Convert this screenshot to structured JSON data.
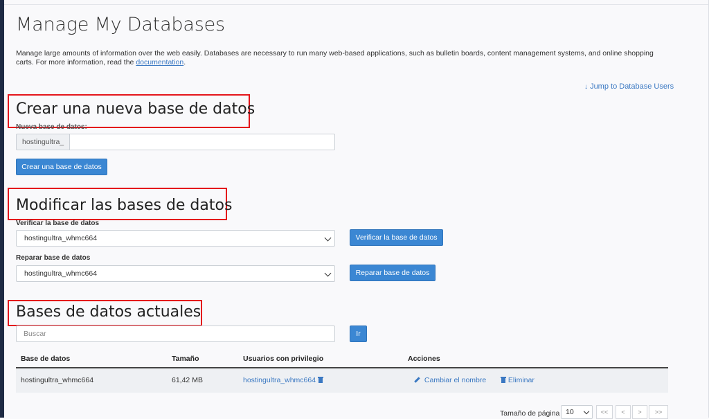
{
  "page": {
    "title": "Manage My Databases",
    "intro_text": "Manage large amounts of information over the web easily. Databases are necessary to run many web-based applications, such as bulletin boards, content management systems, and online shopping carts. For more information, read the",
    "intro_link": "documentation",
    "intro_end": ".",
    "jump_link": "Jump to Database Users"
  },
  "create": {
    "heading": "Crear una nueva base de datos",
    "label": "Nueva base de datos:",
    "prefix": "hostingultra_",
    "input_value": "",
    "button": "Crear una base de datos"
  },
  "modify": {
    "heading": "Modificar las bases de datos",
    "verify_label": "Verificar la base de datos",
    "verify_selected": "hostingultra_whmc664",
    "verify_button": "Verificar la base de datos",
    "repair_label": "Reparar base de datos",
    "repair_selected": "hostingultra_whmc664",
    "repair_button": "Reparar base de datos"
  },
  "current": {
    "heading": "Bases de datos actuales",
    "search_placeholder": "Buscar",
    "go_button": "Ir",
    "columns": [
      "Base de datos",
      "Tamaño",
      "Usuarios con privilegio",
      "Acciones"
    ],
    "rows": [
      {
        "database": "hostingultra_whmc664",
        "size": "61,42 MB",
        "user": "hostingultra_whmc664",
        "rename": "Cambiar el nombre",
        "delete": "Eliminar"
      }
    ],
    "page_size_label": "Tamaño de página",
    "page_size": "10",
    "pager": [
      "<<",
      "<",
      ">",
      ">>"
    ]
  },
  "colors": {
    "accent": "#3b87d3",
    "link": "#3a78c2",
    "highlight": "#e4151b"
  },
  "icons": [
    "arrow-down-icon",
    "chevron-down-icon",
    "pencil-icon",
    "trash-icon"
  ]
}
